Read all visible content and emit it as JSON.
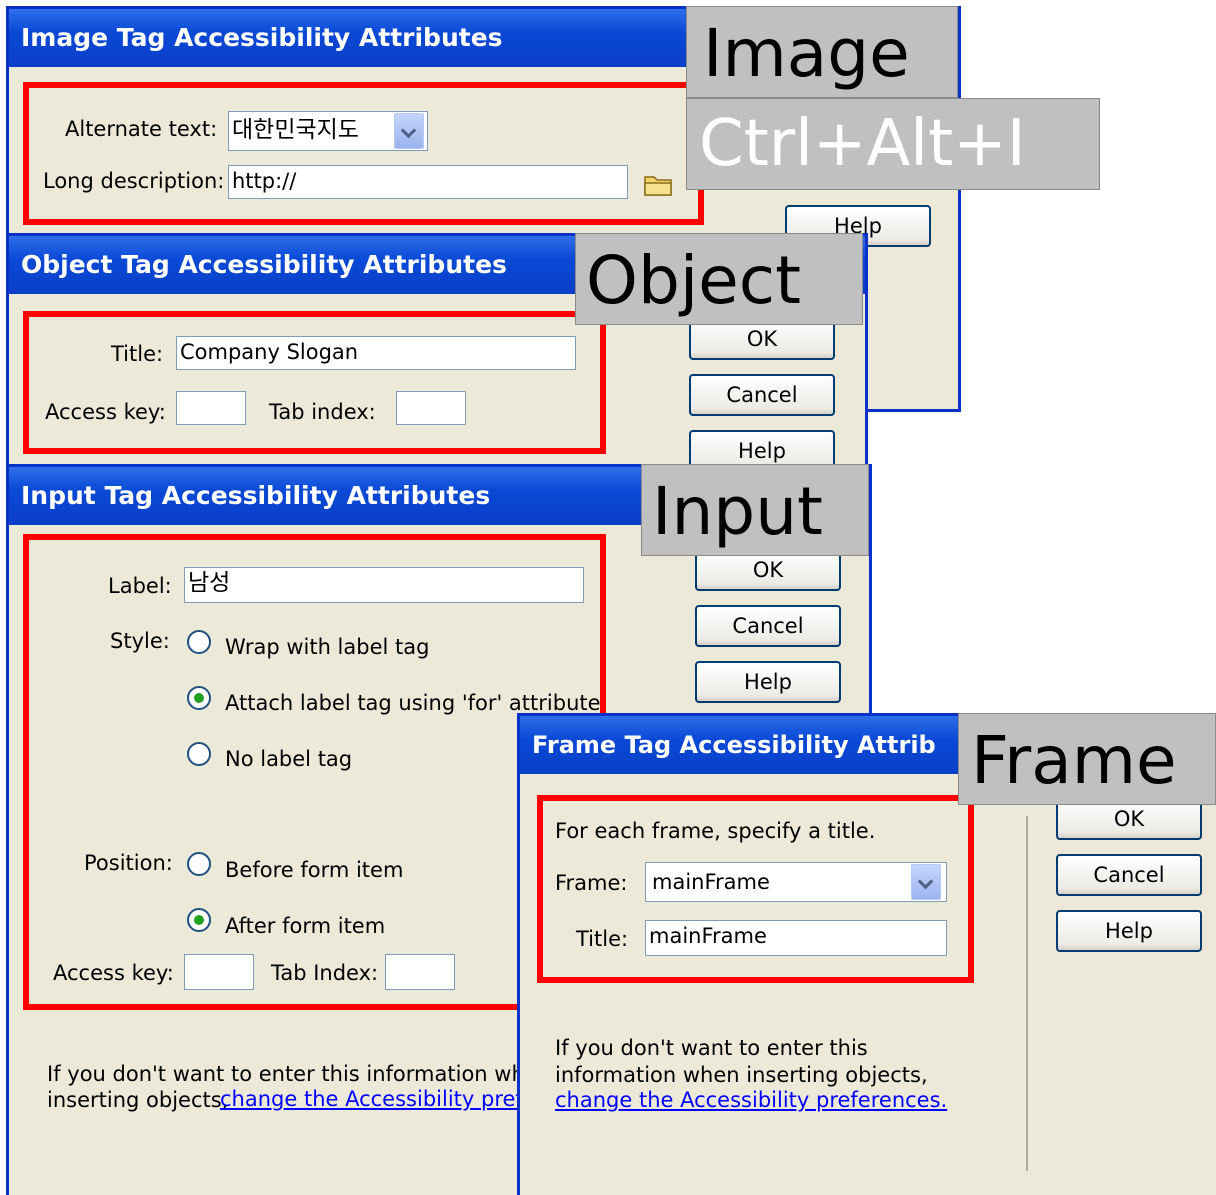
{
  "image_dialog": {
    "title": "Image Tag Accessibility Attributes",
    "alt_label": "Alternate text:",
    "alt_value": "대한민국지도",
    "longdesc_label": "Long description:",
    "longdesc_value": "http://",
    "help": "Help"
  },
  "object_dialog": {
    "title": "Object Tag Accessibility Attributes",
    "title_label": "Title:",
    "title_value": "Company Slogan",
    "access_key_label": "Access key:",
    "access_key_value": "",
    "tab_index_label": "Tab index:",
    "tab_index_value": "",
    "ok": "OK",
    "cancel": "Cancel",
    "help": "Help"
  },
  "input_dialog": {
    "title": "Input Tag Accessibility Attributes",
    "label_label": "Label:",
    "label_value": "남성",
    "style_label": "Style:",
    "style_options": [
      "Wrap with label tag",
      "Attach label tag using 'for' attribute",
      "No label tag"
    ],
    "style_selected": 1,
    "position_label": "Position:",
    "position_options": [
      "Before form item",
      "After form item"
    ],
    "position_selected": 1,
    "access_key_label": "Access key:",
    "tab_index_label": "Tab Index:",
    "note": "If you don't want to enter this information when",
    "note2": "inserting objects, ",
    "link": "change the Accessibility prefere",
    "ok": "OK",
    "cancel": "Cancel",
    "help": "Help"
  },
  "frame_dialog": {
    "title": "Frame Tag Accessibility Attrib",
    "instruction": "For each frame, specify a title.",
    "frame_label": "Frame:",
    "frame_value": "mainFrame",
    "title_label": "Title:",
    "title_value": "mainFrame",
    "note": "If you don't want to enter this\ninformation when inserting objects,",
    "link": "change the Accessibility preferences.",
    "ok": "OK",
    "cancel": "Cancel",
    "help": "Help"
  },
  "tags": {
    "image": "Image",
    "shortcut": "Ctrl+Alt+I",
    "object": "Object",
    "input": "Input",
    "frame": "Frame"
  },
  "colors": {
    "highlight_box": "#ff0000",
    "titlebar": "#0a49d6",
    "dialog_bg": "#ece9d8",
    "tag_bg": "#c0c0c0"
  }
}
